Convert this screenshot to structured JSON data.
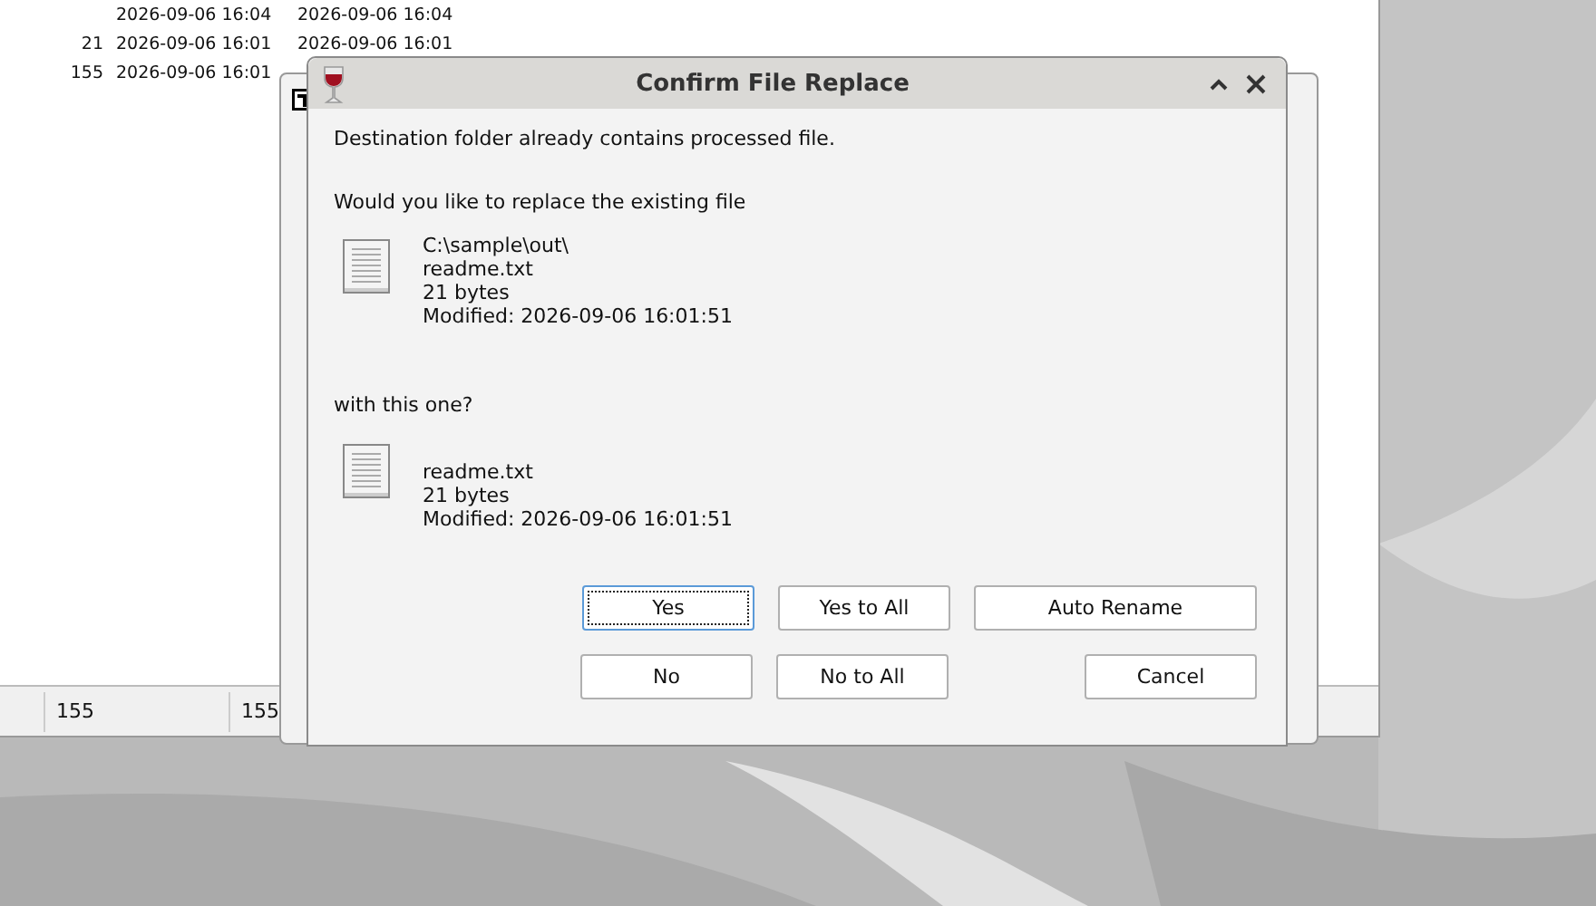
{
  "file_list": {
    "rows": [
      {
        "size": "",
        "created": "2026-09-06 16:04",
        "modified": "2026-09-06 16:04"
      },
      {
        "size": "21",
        "created": "2026-09-06 16:01",
        "modified": "2026-09-06 16:01"
      },
      {
        "size": "155",
        "created": "2026-09-06 16:01",
        "modified": ""
      }
    ]
  },
  "status_bar": [
    "155",
    "155"
  ],
  "dialog": {
    "title": "Confirm File Replace",
    "message": "Destination folder already contains processed file.",
    "question": "Would you like to replace the existing file",
    "existing": [
      "C:\\sample\\out\\",
      "readme.txt",
      "21 bytes",
      "Modified: 2026-09-06 16:01:51"
    ],
    "with_label": "with this one?",
    "new": [
      "readme.txt",
      "21 bytes",
      "Modified: 2026-09-06 16:01:51"
    ],
    "button_rows": [
      [
        {
          "label": "Yes",
          "focused": true
        },
        {
          "label": "Yes to All",
          "focused": false
        },
        {
          "label": "Auto Rename",
          "focused": false
        }
      ],
      [
        {
          "label": "No",
          "focused": false
        },
        {
          "label": "No to All",
          "focused": false
        },
        {
          "label": "Cancel",
          "focused": false
        }
      ]
    ]
  }
}
